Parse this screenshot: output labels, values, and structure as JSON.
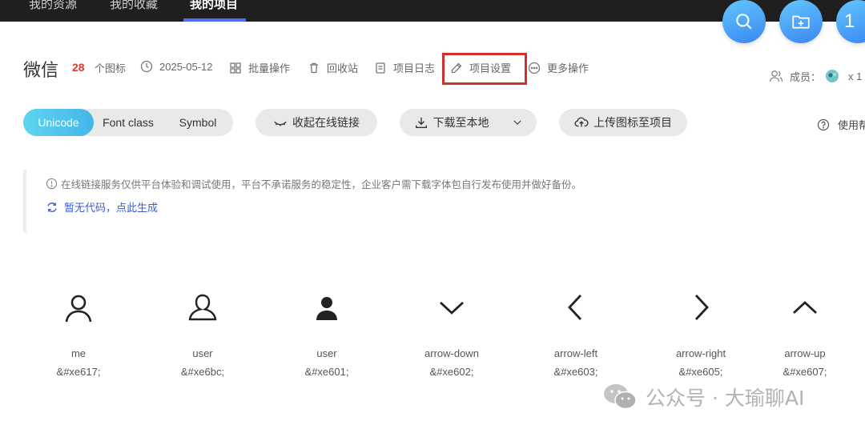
{
  "nav": {
    "tabs": [
      {
        "label": "我的资源"
      },
      {
        "label": "我的收藏"
      },
      {
        "label": "我的项目",
        "active": true
      }
    ],
    "accent": "#4c6ef5"
  },
  "fabs": {
    "search_icon": "search-icon",
    "new_folder_icon": "folder-plus-icon",
    "third_text": "1"
  },
  "project": {
    "name": "微信",
    "icon_count": "28",
    "icon_count_label": "个图标",
    "date": "2025-05-12",
    "actions": [
      {
        "label": "批量操作",
        "icon": "batch-icon"
      },
      {
        "label": "回收站",
        "icon": "trash-icon"
      },
      {
        "label": "项目日志",
        "icon": "log-icon"
      },
      {
        "label": "项目设置",
        "icon": "edit-icon"
      },
      {
        "label": "更多操作",
        "icon": "more-icon"
      }
    ],
    "members_label": "成员：",
    "members_count": "x 1"
  },
  "toolbar": {
    "segments": [
      {
        "label": "Unicode",
        "active": true
      },
      {
        "label": "Font class"
      },
      {
        "label": "Symbol"
      }
    ],
    "collapse_label": "收起在线链接",
    "download_label": "下载至本地",
    "upload_label": "上传图标至项目",
    "help_label": "使用帮"
  },
  "notice": {
    "text": "在线链接服务仅供平台体验和调试使用，平台不承诺服务的稳定性，企业客户需下载字体包自行发布使用并做好备份。",
    "generate_label": "暂无代码，点此生成",
    "link_color": "#3c5cd9"
  },
  "icons": [
    {
      "name": "me",
      "code": "&#xe617;",
      "glyph": "person-outline-icon"
    },
    {
      "name": "user",
      "code": "&#xe6bc;",
      "glyph": "user-outline-icon"
    },
    {
      "name": "user",
      "code": "&#xe601;",
      "glyph": "user-filled-icon"
    },
    {
      "name": "arrow-down",
      "code": "&#xe602;",
      "glyph": "arrow-down-icon"
    },
    {
      "name": "arrow-left",
      "code": "&#xe603;",
      "glyph": "arrow-left-icon"
    },
    {
      "name": "arrow-right",
      "code": "&#xe605;",
      "glyph": "arrow-right-icon"
    },
    {
      "name": "arrow-up",
      "code": "&#xe607;",
      "glyph": "arrow-up-icon"
    }
  ],
  "watermark": {
    "text": "公众号 · 大瑜聊AI"
  }
}
